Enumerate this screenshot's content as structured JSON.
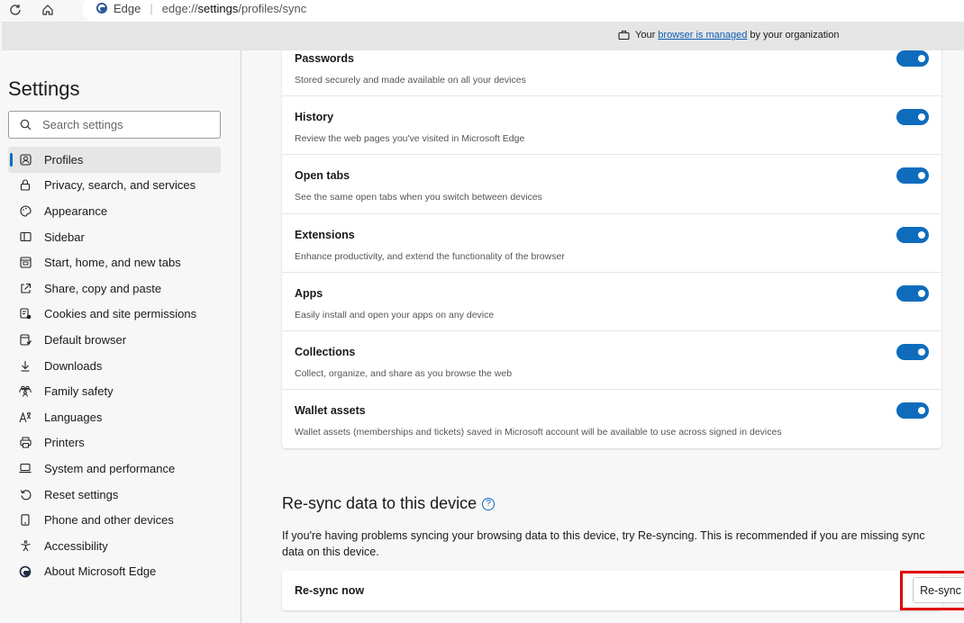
{
  "addressbar": {
    "site_name": "Edge",
    "url_prefix": "edge://",
    "url_strong": "settings",
    "url_suffix": "/profiles/sync"
  },
  "banner": {
    "text_before": "Your",
    "link_text": "browser is managed",
    "text_after": "by your organization"
  },
  "sidebar": {
    "title": "Settings",
    "search_placeholder": "Search settings",
    "items": [
      {
        "label": "Profiles",
        "icon": "profile-icon",
        "active": true
      },
      {
        "label": "Privacy, search, and services",
        "icon": "lock-icon"
      },
      {
        "label": "Appearance",
        "icon": "palette-icon"
      },
      {
        "label": "Sidebar",
        "icon": "sidebar-icon"
      },
      {
        "label": "Start, home, and new tabs",
        "icon": "home-tabs-icon"
      },
      {
        "label": "Share, copy and paste",
        "icon": "share-icon"
      },
      {
        "label": "Cookies and site permissions",
        "icon": "cookies-icon"
      },
      {
        "label": "Default browser",
        "icon": "default-browser-icon"
      },
      {
        "label": "Downloads",
        "icon": "download-icon"
      },
      {
        "label": "Family safety",
        "icon": "family-icon"
      },
      {
        "label": "Languages",
        "icon": "languages-icon"
      },
      {
        "label": "Printers",
        "icon": "printer-icon"
      },
      {
        "label": "System and performance",
        "icon": "laptop-icon"
      },
      {
        "label": "Reset settings",
        "icon": "reset-icon"
      },
      {
        "label": "Phone and other devices",
        "icon": "phone-icon"
      },
      {
        "label": "Accessibility",
        "icon": "accessibility-icon"
      },
      {
        "label": "About Microsoft Edge",
        "icon": "edge-logo-icon"
      }
    ]
  },
  "sync_items": [
    {
      "title": "Passwords",
      "desc": "Stored securely and made available on all your devices",
      "on": true
    },
    {
      "title": "History",
      "desc": "Review the web pages you've visited in Microsoft Edge",
      "on": true
    },
    {
      "title": "Open tabs",
      "desc": "See the same open tabs when you switch between devices",
      "on": true
    },
    {
      "title": "Extensions",
      "desc": "Enhance productivity, and extend the functionality of the browser",
      "on": true
    },
    {
      "title": "Apps",
      "desc": "Easily install and open your apps on any device",
      "on": true
    },
    {
      "title": "Collections",
      "desc": "Collect, organize, and share as you browse the web",
      "on": true
    },
    {
      "title": "Wallet assets",
      "desc": "Wallet assets (memberships and tickets) saved in Microsoft account will be available to use across signed in devices",
      "on": true
    }
  ],
  "resync": {
    "title": "Re-sync data to this device",
    "description": "If you're having problems syncing your browsing data to this device, try Re-syncing. This is recommended if you are missing sync data on this device.",
    "row_label": "Re-sync now",
    "button_label": "Re-sync"
  },
  "colors": {
    "accent": "#0f6cbd",
    "highlight": "#e00000"
  }
}
